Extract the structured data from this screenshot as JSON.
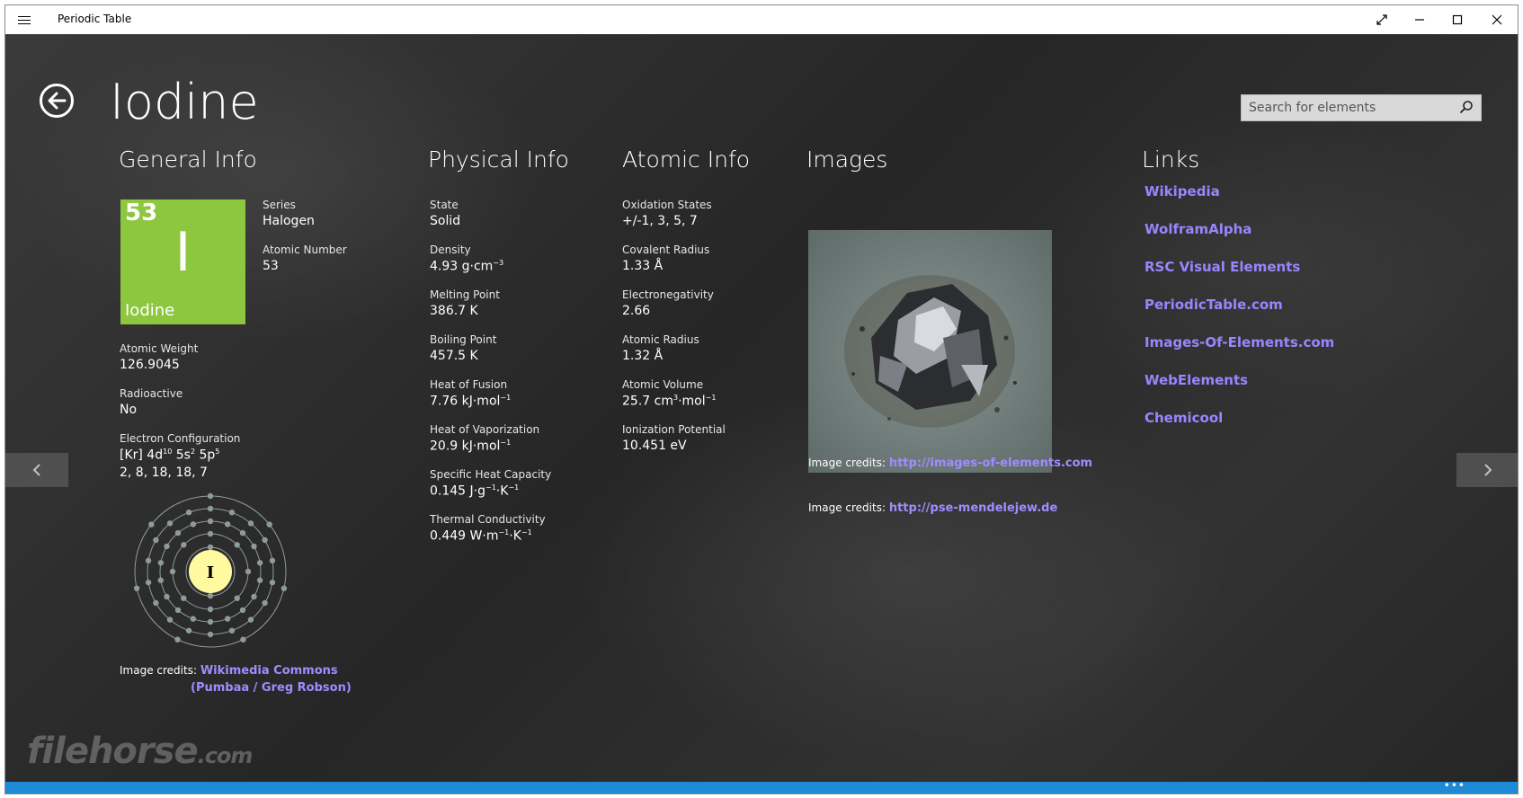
{
  "window": {
    "title": "Periodic Table"
  },
  "page": {
    "title": "Iodine"
  },
  "search": {
    "placeholder": "Search for elements"
  },
  "general": {
    "heading": "General Info",
    "tile": {
      "number": "53",
      "symbol": "I",
      "name": "Iodine",
      "color": "#8dc63f"
    },
    "series": {
      "label": "Series",
      "value": "Halogen"
    },
    "atomic_number": {
      "label": "Atomic Number",
      "value": "53"
    },
    "atomic_weight": {
      "label": "Atomic Weight",
      "value": "126.9045"
    },
    "radioactive": {
      "label": "Radioactive",
      "value": "No"
    },
    "electron_config": {
      "label": "Electron Configuration",
      "shells": "2, 8, 18, 18, 7"
    },
    "diagram_symbol": "I",
    "credit": {
      "label": "Image credits:",
      "link1": "Wikimedia Commons",
      "link2": "(Pumbaa / Greg Robson)"
    }
  },
  "physical": {
    "heading": "Physical Info",
    "state": {
      "label": "State",
      "value": "Solid"
    },
    "density": {
      "label": "Density"
    },
    "melting": {
      "label": "Melting Point",
      "value": "386.7 K"
    },
    "boiling": {
      "label": "Boiling Point",
      "value": "457.5 K"
    },
    "fusion": {
      "label": "Heat of Fusion"
    },
    "vaporization": {
      "label": "Heat of Vaporization"
    },
    "specific_heat": {
      "label": "Specific Heat Capacity"
    },
    "thermal": {
      "label": "Thermal Conductivity"
    }
  },
  "atomic": {
    "heading": "Atomic Info",
    "oxidation": {
      "label": "Oxidation States",
      "value": "+/-1, 3, 5, 7"
    },
    "covalent": {
      "label": "Covalent Radius",
      "value": "1.33 Å"
    },
    "electronegativity": {
      "label": "Electronegativity",
      "value": "2.66"
    },
    "radius": {
      "label": "Atomic Radius",
      "value": "1.32 Å"
    },
    "volume": {
      "label": "Atomic Volume"
    },
    "ionization": {
      "label": "Ionization Potential",
      "value": "10.451 eV"
    }
  },
  "images": {
    "heading": "Images",
    "credit1": {
      "label": "Image credits:",
      "link": "http://images-of-elements.com"
    },
    "credit2": {
      "label": "Image credits:",
      "link": "http://pse-mendelejew.de"
    }
  },
  "links": {
    "heading": "Links",
    "items": [
      "Wikipedia",
      "WolframAlpha",
      "RSC Visual Elements",
      "PeriodicTable.com",
      "Images-Of-Elements.com",
      "WebElements",
      "Chemicool"
    ]
  },
  "watermark": {
    "main": "filehorse",
    "suffix": ".com"
  },
  "colors": {
    "accent": "#1e8ad6",
    "link": "#9a85ff",
    "tile": "#8dc63f"
  }
}
